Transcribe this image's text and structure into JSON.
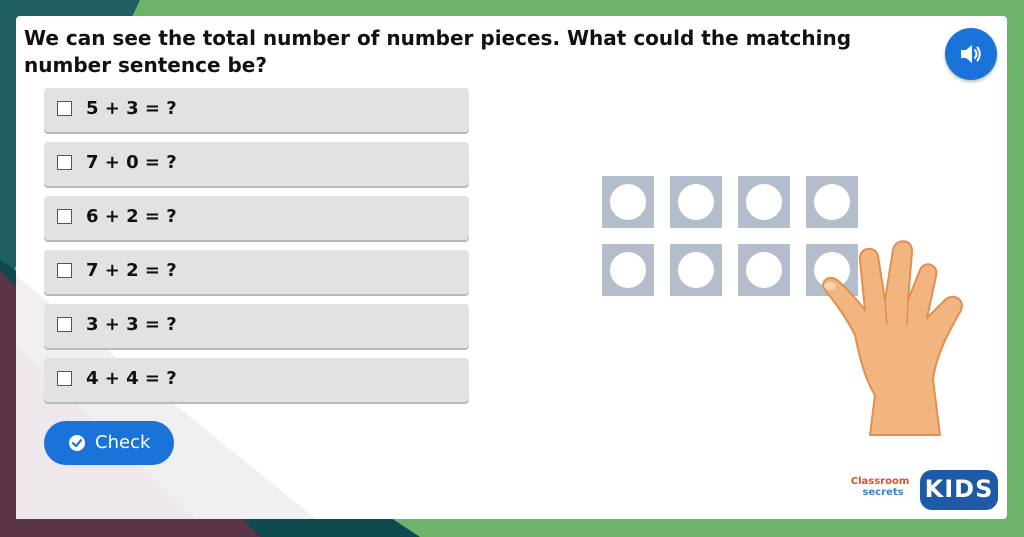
{
  "question": {
    "text": "We can see the total number of number pieces. What could the matching number sentence be?"
  },
  "audio_button": {
    "icon": "speaker-icon"
  },
  "options": [
    {
      "label": "5 + 3 = ?",
      "checked": false
    },
    {
      "label": "7 + 0 = ?",
      "checked": false
    },
    {
      "label": "6 + 2 = ?",
      "checked": false
    },
    {
      "label": "7 + 2 = ?",
      "checked": false
    },
    {
      "label": "3 + 3 = ?",
      "checked": false
    },
    {
      "label": "4 + 4 = ?",
      "checked": false
    }
  ],
  "check_button": {
    "label": "Check",
    "icon": "check-circle-icon"
  },
  "illustration": {
    "rows": 2,
    "columns": 4,
    "piece_count": 8
  },
  "logo": {
    "line1": "Classroom",
    "line2": "secrets",
    "badge": "KIDS"
  },
  "colors": {
    "background_green": "#6db36b",
    "dark_teal": "#0f4a4f",
    "plum": "#5a3447",
    "accent_blue": "#1a73d9",
    "option_grey": "#e2e2e2",
    "piece_grey": "#b3bdcb"
  }
}
